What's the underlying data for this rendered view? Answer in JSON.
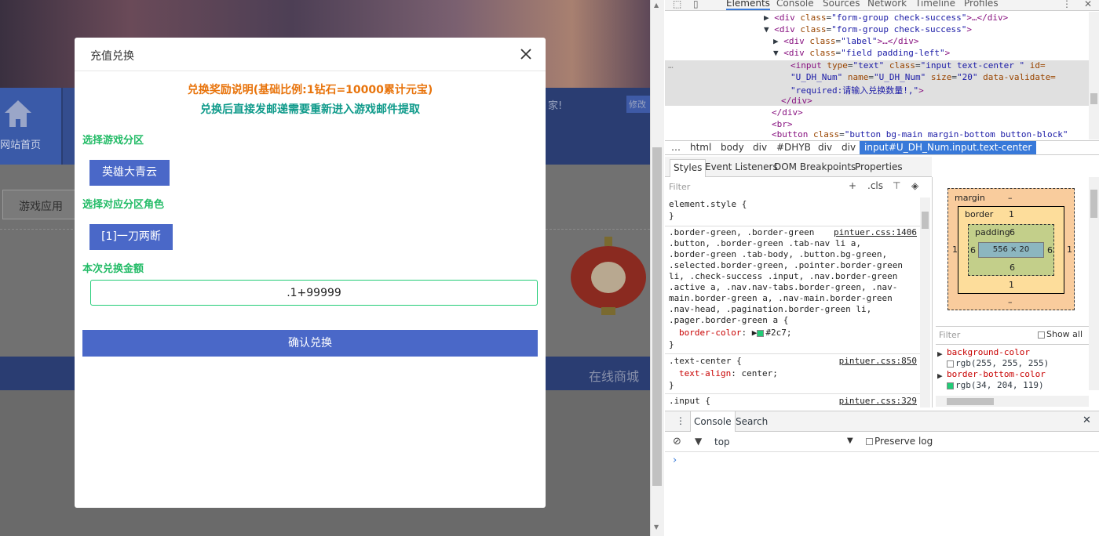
{
  "background": {
    "home_label": "网站首页",
    "notice_text": "家!",
    "notice_button": "修改",
    "tab_label": "游戏应用",
    "footer_mall": "在线商城"
  },
  "modal": {
    "title": "充值兑换",
    "info_line1": "兑换奖励说明(基础比例:1钻石=10000累计元宝)",
    "info_line2": "兑换后直接发邮递需要重新进入游戏邮件提取",
    "section_server": "选择游戏分区",
    "server_value": "英雄大青云",
    "section_role": "选择对应分区角色",
    "role_value": "[1]一刀两断",
    "section_amount": "本次兑换金额",
    "amount_value": ".1+99999",
    "confirm_label": "确认兑换"
  },
  "devtools": {
    "tabs": [
      "Elements",
      "Console",
      "Sources",
      "Network",
      "Timeline",
      "Profiles"
    ],
    "dom_lines": {
      "l1_tag": "<div",
      "l1_attr": "class",
      "l1_val": "\"form-group check-success\"",
      "l1_end": ">…</div>",
      "l2_tag": "<div",
      "l2_attr": "class",
      "l2_val": "\"form-group check-success\"",
      "l2_end": ">",
      "l3_tag": "<div",
      "l3_attr": "class",
      "l3_val": "\"label\"",
      "l3_end": ">…</div>",
      "l4_tag": "<div",
      "l4_attr": "class",
      "l4_val": "\"field padding-left\"",
      "l4_end": ">",
      "l5a": "<input",
      "l5b": "type",
      "l5c": "\"text\"",
      "l5d": "class",
      "l5e": "\"input  text-center \"",
      "l5f": "id=",
      "l6a": "\"U_DH_Num\"",
      "l6b": "name",
      "l6c": "\"U_DH_Num\"",
      "l6d": "size",
      "l6e": "\"20\"",
      "l6f": "data-validate=",
      "l7a": "\"required:请输入兑换数量!,\"",
      "l7b": ">",
      "l8": "</div>",
      "l9": "</div>",
      "l10": "<br>",
      "l11_tag": "<button",
      "l11_attr": "class",
      "l11_val": "\"button bg-main margin-bottom button-block\""
    },
    "breadcrumbs": [
      "…",
      "html",
      "body",
      "div",
      "#DHYB",
      "div",
      "div"
    ],
    "breadcrumb_active": "input#U_DH_Num.input.text-center",
    "sub_tabs": [
      "Styles",
      "Event Listeners",
      "DOM Breakpoints",
      "Properties"
    ],
    "filter_placeholder": "Filter",
    "filter_tools": [
      "+",
      ".cls"
    ],
    "styles": {
      "element_style": "element.style {",
      "close": "}",
      "rule1_sel1": ".border-green, .border-green",
      "rule1_src": "pintuer.css:1406",
      "rule1_sel2": ".button, .border-green .tab-nav li a,",
      "rule1_sel3": ".border-green .tab-body, .button.bg-green,",
      "rule1_sel4": ".selected.border-green, .pointer.border-green",
      "rule1_sel5": "li, .check-success .input, .nav.border-green",
      "rule1_sel6": ".active a, .nav.nav-tabs.border-green, .nav-",
      "rule1_sel7": "main.border-green a, .nav-main.border-green",
      "rule1_sel8": ".nav-head, .pagination.border-green li,",
      "rule1_sel9": ".pager.border-green a {",
      "rule1_prop": "border-color",
      "rule1_val": "#2c7;",
      "rule2_sel": ".text-center {",
      "rule2_src": "pintuer.css:850",
      "rule2_prop": "text-align",
      "rule2_val": "center;",
      "rule3_sel": ".input {",
      "rule3_src": "pintuer.css:329"
    },
    "box_model": {
      "margin_label": "margin",
      "margin_top": "–",
      "margin_bottom": "–",
      "border_label": "border",
      "border_top": "1",
      "border_bottom": "1",
      "border_left": "1",
      "border_right": "1",
      "padding_label": "padding",
      "padding_top": "6",
      "padding_bottom": "6",
      "padding_left": "6",
      "padding_right": "6",
      "content": "556 × 20"
    },
    "computed_filter": "Filter",
    "show_all": "Show all",
    "computed": {
      "p1": "background-color",
      "v1": "rgb(255, 255, 255)",
      "p2": "border-bottom-color",
      "v2": "rgb(34, 204, 119)"
    },
    "console_tabs": [
      "Console",
      "Search"
    ],
    "context": "top",
    "preserve_log": "Preserve log",
    "prompt": "›"
  },
  "colors": {
    "accent_blue": "#4a68c8",
    "green": "#22cc77",
    "orange": "#e8740c",
    "teal": "#0e9a8a"
  }
}
